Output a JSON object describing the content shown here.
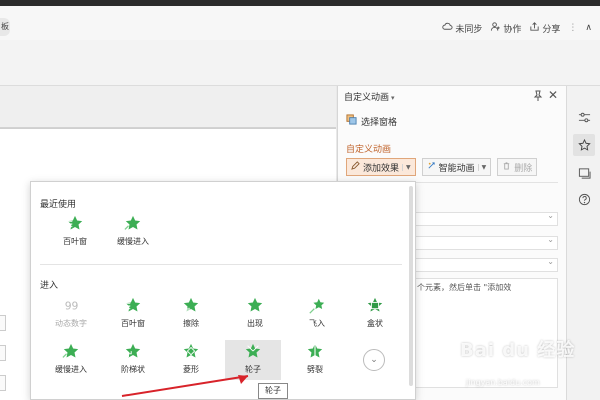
{
  "titlebar": {
    "tab_fragment": "板",
    "actions": [
      {
        "icon": "cloud-icon",
        "label": "未同步"
      },
      {
        "icon": "collaborate-icon",
        "label": "协作"
      },
      {
        "icon": "share-icon",
        "label": "分享"
      }
    ],
    "more_symbol": "⋮",
    "collapse_symbol": "∧"
  },
  "pane": {
    "header": "自定义动画",
    "header_caret": "▾",
    "close_symbol": "✕",
    "select_pane_label": "选择窗格",
    "custom_title": "自定义动画",
    "add_effect": "添加效果",
    "smart_anim": "智能动画",
    "delete": "删除",
    "hint": "个元素，然后单击 \"添加效"
  },
  "popup": {
    "recent_title": "最近使用",
    "recent": [
      {
        "icon": "blinds-effect-icon",
        "label": "百叶窗"
      },
      {
        "icon": "slow-in-effect-icon",
        "label": "缓慢进入"
      }
    ],
    "enter_title": "进入",
    "row1": [
      {
        "icon": "dynamic-number-effect-icon",
        "label": "动态数字",
        "dim": true
      },
      {
        "icon": "blinds-effect-icon",
        "label": "百叶窗"
      },
      {
        "icon": "wipe-effect-icon",
        "label": "擦除"
      },
      {
        "icon": "appear-effect-icon",
        "label": "出现"
      },
      {
        "icon": "fly-in-effect-icon",
        "label": "飞入"
      },
      {
        "icon": "box-effect-icon",
        "label": "盒状"
      }
    ],
    "row2": [
      {
        "icon": "slow-in-effect-icon",
        "label": "缓慢进入"
      },
      {
        "icon": "stairs-effect-icon",
        "label": "阶梯状"
      },
      {
        "icon": "diamond-effect-icon",
        "label": "菱形"
      },
      {
        "icon": "wheel-effect-icon",
        "label": "轮子"
      },
      {
        "icon": "split-effect-icon",
        "label": "劈裂"
      }
    ],
    "more_symbol": "⌄"
  },
  "tooltip": "轮子",
  "watermark": {
    "main": "Bai du 经验",
    "sub": "jingyan.baidu.com"
  },
  "colors": {
    "accent": "#c0632b",
    "star": "#3cae54",
    "arrow": "#d8232a"
  }
}
